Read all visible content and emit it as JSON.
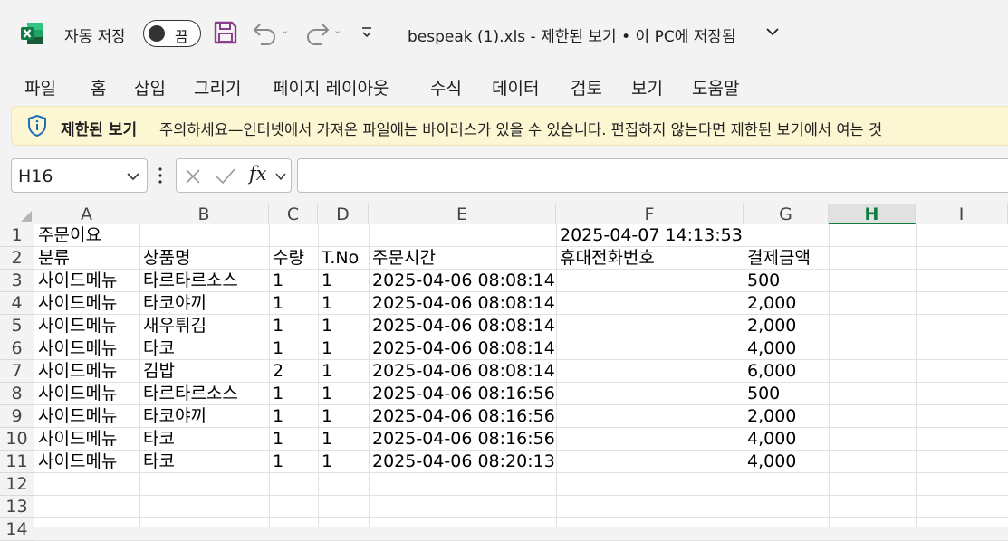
{
  "titlebar": {
    "autosave_label": "자동 저장",
    "toggle_label": "끔",
    "document_title": "bespeak (1).xls  -  제한된 보기 • 이 PC에 저장됨"
  },
  "menu": [
    "파일",
    "홈",
    "삽입",
    "그리기",
    "페이지 레이아웃",
    "수식",
    "데이터",
    "검토",
    "보기",
    "도움말"
  ],
  "infobar": {
    "title": "제한된 보기",
    "message": "주의하세요—인터넷에서 가져온 파일에는 바이러스가 있을 수 있습니다. 편집하지 않는다면 제한된 보기에서 여는 것"
  },
  "formula_bar": {
    "name_box": "H16",
    "fx_label": "fx",
    "formula": ""
  },
  "sheet": {
    "columns": [
      "A",
      "B",
      "C",
      "D",
      "E",
      "F",
      "G",
      "H",
      "I"
    ],
    "selected_column": "H",
    "row_numbers": [
      "1",
      "2",
      "3",
      "4",
      "5",
      "6",
      "7",
      "8",
      "9",
      "10",
      "11",
      "12",
      "13",
      "14"
    ],
    "rows": [
      [
        "주문이요",
        "",
        "",
        "",
        "",
        "2025-04-07 14:13:53",
        "",
        "",
        ""
      ],
      [
        "분류",
        "상품명",
        "수량",
        "T.No",
        "주문시간",
        "휴대전화번호",
        "결제금액",
        "",
        ""
      ],
      [
        "사이드메뉴",
        "타르타르소스",
        "1",
        "1",
        "2025-04-06 08:08:14",
        "",
        "500",
        "",
        ""
      ],
      [
        "사이드메뉴",
        "타코야끼",
        "1",
        "1",
        "2025-04-06 08:08:14",
        "",
        "2,000",
        "",
        ""
      ],
      [
        "사이드메뉴",
        "새우튀김",
        "1",
        "1",
        "2025-04-06 08:08:14",
        "",
        "2,000",
        "",
        ""
      ],
      [
        "사이드메뉴",
        "타코",
        "1",
        "1",
        "2025-04-06 08:08:14",
        "",
        "4,000",
        "",
        ""
      ],
      [
        "사이드메뉴",
        "김밥",
        "2",
        "1",
        "2025-04-06 08:08:14",
        "",
        "6,000",
        "",
        ""
      ],
      [
        "사이드메뉴",
        "타르타르소스",
        "1",
        "1",
        "2025-04-06 08:16:56",
        "",
        "500",
        "",
        ""
      ],
      [
        "사이드메뉴",
        "타코야끼",
        "1",
        "1",
        "2025-04-06 08:16:56",
        "",
        "2,000",
        "",
        ""
      ],
      [
        "사이드메뉴",
        "타코",
        "1",
        "1",
        "2025-04-06 08:16:56",
        "",
        "4,000",
        "",
        ""
      ],
      [
        "사이드메뉴",
        "타코",
        "1",
        "1",
        "2025-04-06 08:20:13",
        "",
        "4,000",
        "",
        ""
      ],
      [
        "",
        "",
        "",
        "",
        "",
        "",
        "",
        "",
        ""
      ],
      [
        "",
        "",
        "",
        "",
        "",
        "",
        "",
        "",
        ""
      ],
      [
        "",
        "",
        "",
        "",
        "",
        "",
        "",
        "",
        ""
      ]
    ]
  },
  "colors": {
    "excel_green": "#107c41",
    "save_purple": "#8b3d8b",
    "info_bg": "#fdf6d2",
    "shield_blue": "#1a6fb8"
  }
}
